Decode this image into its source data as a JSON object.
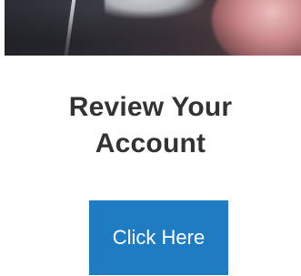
{
  "content": {
    "heading_line1": "Review Your",
    "heading_line2": "Account",
    "cta_label": "Click Here"
  },
  "colors": {
    "heading": "#333333",
    "cta_bg": "#1f7cc3",
    "cta_text": "#ffffff",
    "background": "#ffffff"
  }
}
